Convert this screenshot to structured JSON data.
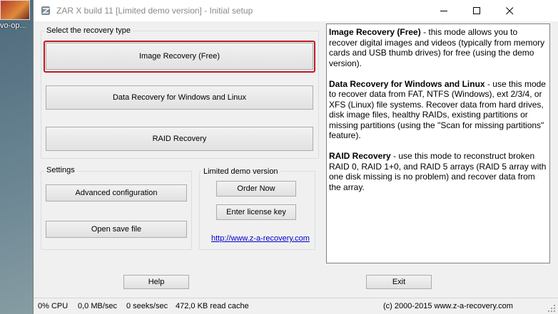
{
  "desktop": {
    "icon_label": "vo-op..."
  },
  "window": {
    "title": "ZAR X build 11 [Limited demo version] - Initial setup"
  },
  "recovery": {
    "group_label": "Select the recovery type",
    "image_button": "Image Recovery (Free)",
    "data_button": "Data Recovery for Windows and Linux",
    "raid_button": "RAID Recovery"
  },
  "settings": {
    "group_label": "Settings",
    "advanced_button": "Advanced configuration",
    "open_save_button": "Open save file"
  },
  "demo": {
    "group_label": "Limited demo version",
    "order_button": "Order Now",
    "license_button": "Enter license key",
    "link": "http://www.z-a-recovery.com"
  },
  "info": {
    "image_title": "Image Recovery (Free)",
    "image_text": " - this mode allows you to recover digital images and videos (typically from memory cards and USB thumb drives) for free (using the demo version).",
    "data_title": "Data Recovery for Windows and Linux",
    "data_text": " - use this mode to recover data from FAT, NTFS (Windows), ext 2/3/4, or XFS (Linux) file systems. Recover data from hard drives, disk image files, healthy RAIDs, existing partitions or missing partitions (using the \"Scan for missing partitions\" feature).",
    "raid_title": "RAID Recovery",
    "raid_text": " - use this mode to reconstruct broken RAID 0, RAID 1+0, and RAID 5 arrays (RAID 5 array with one disk missing is no problem) and recover data from the array."
  },
  "footer": {
    "help_button": "Help",
    "exit_button": "Exit"
  },
  "status": {
    "cpu": "0% CPU",
    "mbsec": "0,0 MB/sec",
    "seeks": "0 seeks/sec",
    "cache": "472,0 KB read cache",
    "copyright": "(c) 2000-2015 www.z-a-recovery.com"
  }
}
